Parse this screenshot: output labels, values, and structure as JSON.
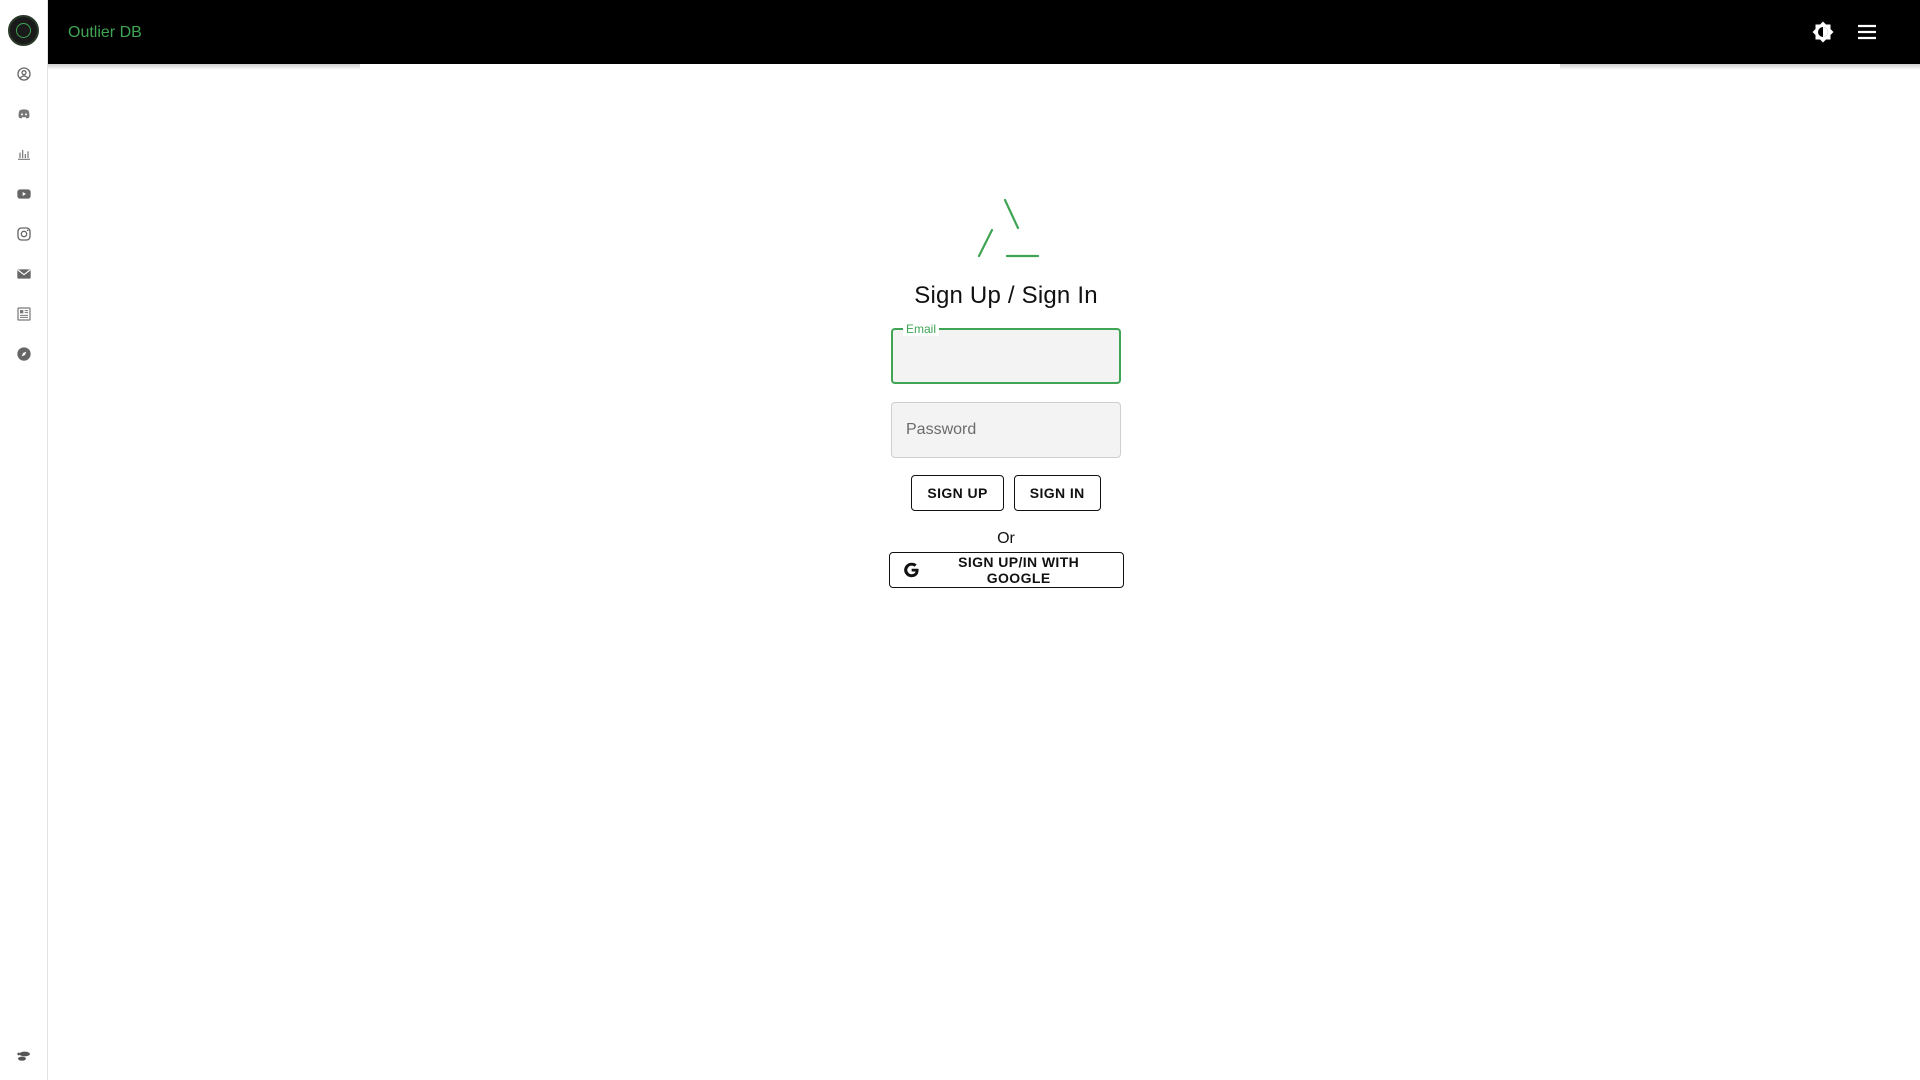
{
  "app": {
    "title": "Outlier DB"
  },
  "sidebar": {
    "items": [
      {
        "icon": "account-circle-icon"
      },
      {
        "icon": "discord-icon"
      },
      {
        "icon": "bar-chart-icon"
      },
      {
        "icon": "youtube-icon"
      },
      {
        "icon": "instagram-icon"
      },
      {
        "icon": "mail-icon"
      },
      {
        "icon": "newspaper-icon"
      },
      {
        "icon": "compass-icon"
      }
    ],
    "bottom_icon": "settings-toggle-icon"
  },
  "topbar": {
    "theme_icon": "brightness-icon",
    "menu_icon": "menu-icon"
  },
  "auth": {
    "title": "Sign Up / Sign In",
    "email": {
      "label": "Email",
      "value": ""
    },
    "password": {
      "placeholder": "Password",
      "value": ""
    },
    "sign_up_label": "SIGN UP",
    "sign_in_label": "SIGN IN",
    "or_text": "Or",
    "google_label": "SIGN UP/IN WITH GOOGLE"
  },
  "colors": {
    "accent": "#3fa554",
    "topbar_bg": "#000000",
    "field_bg": "#f3f3f3"
  }
}
